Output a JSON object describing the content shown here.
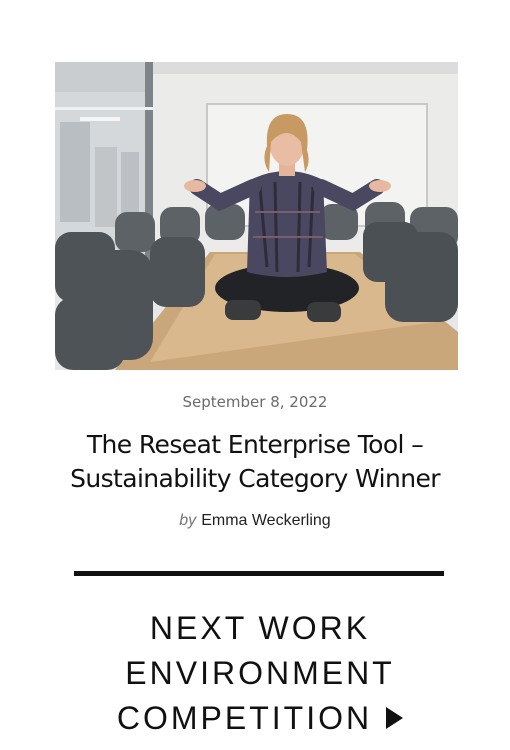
{
  "article": {
    "date": "September 8, 2022",
    "title": "The Reseat Enterprise Tool – Sustainability Category Winner",
    "byline_prefix": "by",
    "author": "Emma Weckerling"
  },
  "cta": {
    "line1": "NEXT WORK",
    "line2": "ENVIRONMENT",
    "line3": "COMPETITION",
    "arrow_icon": "play-triangle-icon"
  },
  "colors": {
    "text": "#111111",
    "muted": "#6b6b6b",
    "rule": "#111111"
  }
}
